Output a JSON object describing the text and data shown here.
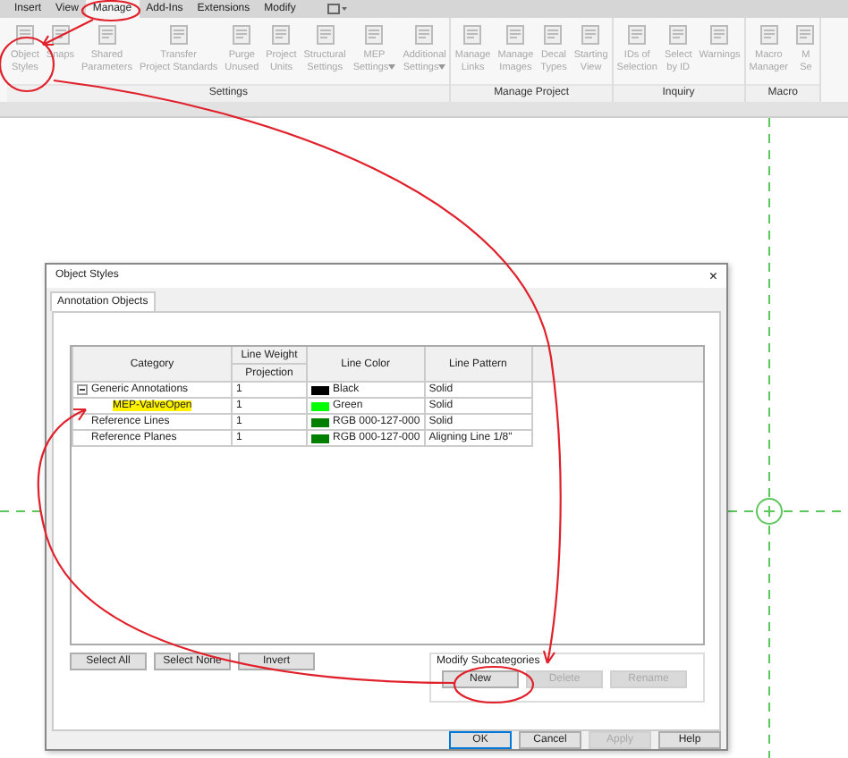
{
  "tabs": [
    {
      "label": "Insert",
      "selected": false
    },
    {
      "label": "View",
      "selected": false
    },
    {
      "label": "Manage",
      "selected": true
    },
    {
      "label": "Add-Ins",
      "selected": false
    },
    {
      "label": "Extensions",
      "selected": false
    },
    {
      "label": "Modify",
      "selected": false
    }
  ],
  "ribbon": [
    {
      "title": "Settings",
      "items": [
        {
          "label": "Object\nStyles",
          "disabled": true
        },
        {
          "label": "Snaps",
          "disabled": true
        },
        {
          "label": "Shared\nParameters",
          "disabled": true
        },
        {
          "label": "Transfer\nProject Standards",
          "disabled": true
        },
        {
          "label": "Purge\nUnused",
          "disabled": true
        },
        {
          "label": "Project\nUnits",
          "disabled": true
        },
        {
          "label": "Structural\nSettings",
          "disabled": true
        },
        {
          "label": "MEP\nSettings",
          "disabled": true,
          "dropdown": true
        },
        {
          "label": "Additional\nSettings",
          "disabled": true,
          "dropdown": true
        }
      ]
    },
    {
      "title": "Manage Project",
      "items": [
        {
          "label": "Manage\nLinks",
          "disabled": true
        },
        {
          "label": "Manage\nImages",
          "disabled": true
        },
        {
          "label": "Decal\nTypes",
          "disabled": true
        },
        {
          "label": "Starting\nView",
          "disabled": true
        }
      ]
    },
    {
      "title": "Inquiry",
      "items": [
        {
          "label": "IDs of\nSelection",
          "disabled": true
        },
        {
          "label": "Select\nby ID",
          "disabled": true
        },
        {
          "label": "Warnings",
          "disabled": true
        }
      ]
    },
    {
      "title": "Macro",
      "items": [
        {
          "label": "Macro\nManager",
          "disabled": true
        },
        {
          "label": "M\nSe",
          "disabled": true
        }
      ]
    }
  ],
  "dialog": {
    "title": "Object Styles",
    "close": "×",
    "tabs": [
      {
        "label": "Annotation Objects",
        "selected": true
      }
    ],
    "table": {
      "columns": [
        {
          "label": "Category"
        },
        {
          "label": "Line Weight",
          "sublabel": "Projection"
        },
        {
          "label": "Line Color"
        },
        {
          "label": "Line Pattern"
        }
      ],
      "rows": [
        {
          "category": "Generic Annotations",
          "weight": "1",
          "color_name": "Black",
          "color": "#000000",
          "pattern": "Solid",
          "expanded": true,
          "children": [
            {
              "category": "MEP-ValveOpen",
              "highlighted": true,
              "weight": "1",
              "color_name": "Green",
              "color": "#00ff00",
              "pattern": "Solid"
            }
          ]
        },
        {
          "category": "Reference Lines",
          "weight": "1",
          "color_name": "RGB 000-127-000",
          "color": "#007f00",
          "pattern": "Solid"
        },
        {
          "category": "Reference Planes",
          "weight": "1",
          "color_name": "RGB 000-127-000",
          "color": "#007f00",
          "pattern": "Aligning Line 1/8\""
        }
      ]
    },
    "select_buttons": [
      "Select All",
      "Select None",
      "Invert"
    ],
    "subcategories": {
      "title": "Modify Subcategories",
      "buttons": [
        {
          "label": "New",
          "disabled": false
        },
        {
          "label": "Delete",
          "disabled": true
        },
        {
          "label": "Rename",
          "disabled": true
        }
      ]
    },
    "footer": [
      {
        "label": "OK",
        "disabled": false,
        "default": true
      },
      {
        "label": "Cancel",
        "disabled": false,
        "default": false
      },
      {
        "label": "Apply",
        "disabled": true,
        "default": false
      },
      {
        "label": "Help",
        "disabled": false,
        "default": false
      }
    ]
  }
}
